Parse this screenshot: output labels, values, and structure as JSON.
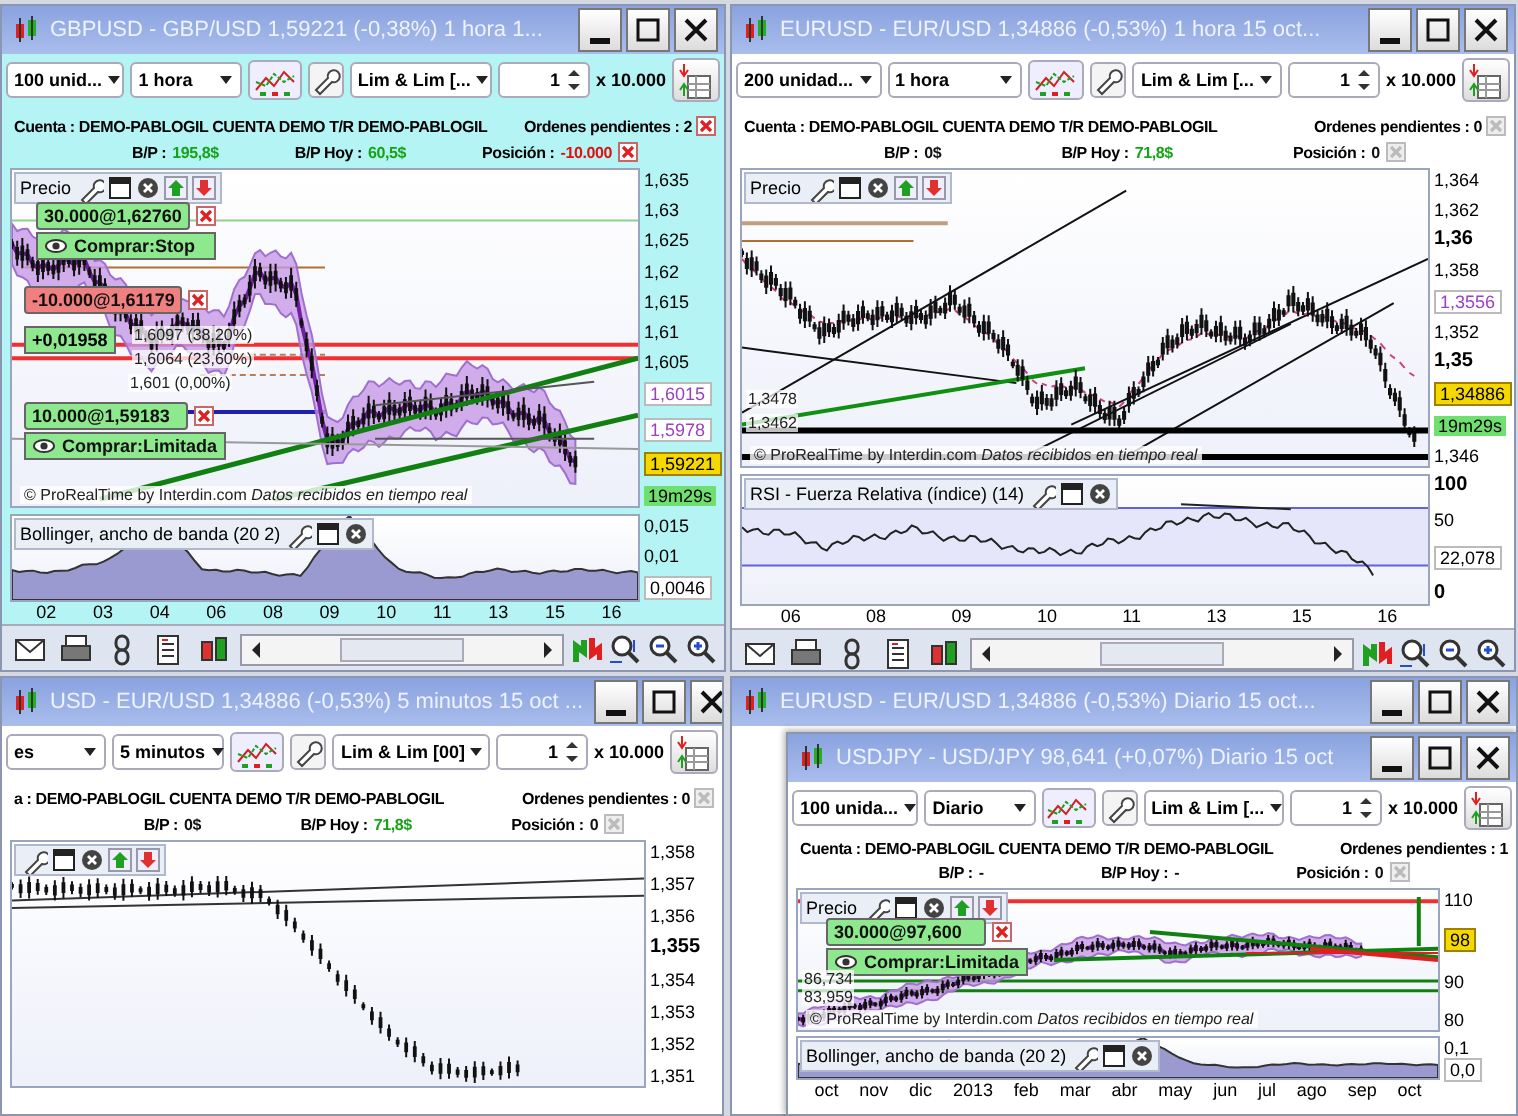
{
  "windows": [
    {
      "title": "GBPUSD - GBP/USD 1,59221 (-0,38%) 1 hora 1...",
      "focused": true,
      "toolbar": {
        "units": "100 unid...",
        "timeframe": "1 hora",
        "order_type": "Lim & Lim [...",
        "quantity": "1",
        "multiplier": "x 10.000"
      },
      "account": {
        "cuenta": "Cuenta : DEMO-PABLOGIL CUENTA DEMO T/R DEMO-PABLOGIL",
        "pending_label": "Ordenes pendientes :",
        "pending": "2",
        "pending_cancel_enabled": true,
        "stats": [
          {
            "label": "B/P :",
            "value": "195,8$",
            "color": "#17a317"
          },
          {
            "label": "B/P Hoy :",
            "value": "60,5$",
            "color": "#17a317"
          },
          {
            "label": "Posición :",
            "value": "-10.000",
            "color": "#e01010",
            "cancel_enabled": true
          }
        ]
      },
      "price_pane": {
        "label": "Precio",
        "overlays": [
          {
            "kind": "order",
            "text": "30.000@1,62760",
            "action": "Comprar:Stop",
            "color": "#8ee88e"
          },
          {
            "kind": "order",
            "text": "-10.000@1,61179",
            "color": "#f08080"
          },
          {
            "kind": "pnl",
            "text": "+0,01958"
          },
          {
            "kind": "level",
            "text": "1,6097 (38,20%)"
          },
          {
            "kind": "level",
            "text": "1,6064 (23,60%)"
          },
          {
            "kind": "level",
            "text": "1,601 (0,00%)"
          },
          {
            "kind": "order",
            "text": "10.000@1,59183",
            "action": "Comprar:Limitada",
            "color": "#8ee88e"
          },
          {
            "kind": "note",
            "text": "© ProRealTime by Interdin.com  *Datos recibidos en tiempo real*"
          }
        ],
        "axis": [
          {
            "kind": "tick",
            "text": "1,635"
          },
          {
            "kind": "tick",
            "text": "1,63"
          },
          {
            "kind": "tick",
            "text": "1,625"
          },
          {
            "kind": "tick",
            "text": "1,62"
          },
          {
            "kind": "tick",
            "text": "1,615"
          },
          {
            "kind": "tick",
            "text": "1,61"
          },
          {
            "kind": "tick",
            "text": "1,605"
          },
          {
            "kind": "level",
            "text": "1,6015"
          },
          {
            "kind": "level",
            "text": "1,5978"
          },
          {
            "kind": "price",
            "text": "1,59221"
          },
          {
            "kind": "timer",
            "text": "19m29s"
          }
        ]
      },
      "indicator": {
        "label": "Bollinger, ancho de banda (20 2)",
        "axis": [
          {
            "kind": "tick",
            "text": "0,015"
          },
          {
            "kind": "tick",
            "text": "0,01"
          },
          {
            "kind": "value",
            "text": "0,0046"
          }
        ]
      },
      "x_labels": [
        "02",
        "03",
        "04",
        "06",
        "08",
        "09",
        "10",
        "11",
        "13",
        "15",
        "16"
      ],
      "navigation_bar": true
    },
    {
      "title": "EURUSD - EUR/USD 1,34886 (-0,53%) 1 hora 15 oct...",
      "focused": false,
      "toolbar": {
        "units": "200 unidad...",
        "timeframe": "1 hora",
        "order_type": "Lim & Lim [...",
        "quantity": "1",
        "multiplier": "x 10.000"
      },
      "account": {
        "cuenta": "Cuenta : DEMO-PABLOGIL CUENTA DEMO T/R DEMO-PABLOGIL",
        "pending_label": "Ordenes pendientes :",
        "pending": "0",
        "pending_cancel_enabled": false,
        "stats": [
          {
            "label": "B/P :",
            "value": "0$",
            "color": "#111111"
          },
          {
            "label": "B/P Hoy :",
            "value": "71,8$",
            "color": "#17a317"
          },
          {
            "label": "Posición :",
            "value": "0",
            "color": "#111111",
            "cancel_enabled": false
          }
        ]
      },
      "price_pane": {
        "label": "Precio",
        "overlays": [
          {
            "kind": "level",
            "text": "1,3478"
          },
          {
            "kind": "level",
            "text": "1,3462"
          },
          {
            "kind": "note",
            "text": "© ProRealTime by Interdin.com  *Datos recibidos en tiempo real*"
          }
        ],
        "axis": [
          {
            "kind": "tick",
            "text": "1,364"
          },
          {
            "kind": "tick",
            "text": "1,362"
          },
          {
            "kind": "major",
            "text": "1,36"
          },
          {
            "kind": "tick",
            "text": "1,358"
          },
          {
            "kind": "level",
            "text": "1,3556"
          },
          {
            "kind": "tick",
            "text": "1,352"
          },
          {
            "kind": "major",
            "text": "1,35"
          },
          {
            "kind": "price",
            "text": "1,34886"
          },
          {
            "kind": "timer",
            "text": "19m29s"
          },
          {
            "kind": "tick",
            "text": "1,346"
          }
        ]
      },
      "indicator": {
        "label": "RSI - Fuerza Relativa (índice) (14)",
        "axis": [
          {
            "kind": "major",
            "text": "100"
          },
          {
            "kind": "tick",
            "text": "50"
          },
          {
            "kind": "value",
            "text": "22,078"
          },
          {
            "kind": "major",
            "text": "0"
          }
        ]
      },
      "x_labels": [
        "06",
        "08",
        "09",
        "10",
        "11",
        "13",
        "15",
        "16"
      ],
      "navigation_bar": true
    },
    {
      "title": "USD - EUR/USD 1,34886 (-0,53%) 5 minutos 15 oct ...",
      "focused": false,
      "toolbar": {
        "units": "es",
        "timeframe": "5 minutos",
        "order_type": "Lim & Lim [00]",
        "quantity": "1",
        "multiplier": "x 10.000"
      },
      "account": {
        "cuenta": "a : DEMO-PABLOGIL CUENTA DEMO T/R DEMO-PABLOGIL",
        "pending_label": "Ordenes pendientes :",
        "pending": "0",
        "pending_cancel_enabled": false,
        "stats": [
          {
            "label": "B/P :",
            "value": "0$",
            "color": "#111111"
          },
          {
            "label": "B/P Hoy :",
            "value": "71,8$",
            "color": "#17a317"
          },
          {
            "label": "Posición :",
            "value": "0",
            "color": "#111111",
            "cancel_enabled": false
          }
        ]
      },
      "price_pane": {
        "axis": [
          {
            "kind": "tick",
            "text": "1,358"
          },
          {
            "kind": "tick",
            "text": "1,357"
          },
          {
            "kind": "tick",
            "text": "1,356"
          },
          {
            "kind": "major",
            "text": "1,355"
          },
          {
            "kind": "tick",
            "text": "1,354"
          },
          {
            "kind": "tick",
            "text": "1,353"
          },
          {
            "kind": "tick",
            "text": "1,352"
          },
          {
            "kind": "tick",
            "text": "1,351"
          }
        ]
      }
    },
    {
      "title": "EURUSD - EUR/USD 1,34886 (-0,53%) Diario 15 oct...",
      "focused": false
    },
    {
      "title": "USDJPY - USD/JPY 98,641 (+0,07%) Diario 15 oct",
      "focused": false,
      "toolbar": {
        "units": "100 unida...",
        "timeframe": "Diario",
        "order_type": "Lim & Lim [...",
        "quantity": "1",
        "multiplier": "x 10.000"
      },
      "account": {
        "cuenta": "Cuenta : DEMO-PABLOGIL CUENTA DEMO T/R DEMO-PABLOGIL",
        "pending_label": "Ordenes pendientes :",
        "pending": "1",
        "stats": [
          {
            "label": "B/P :",
            "value": "-",
            "color": "#111111"
          },
          {
            "label": "B/P Hoy :",
            "value": "-",
            "color": "#111111"
          },
          {
            "label": "Posición :",
            "value": "0",
            "color": "#111111",
            "cancel_enabled": false
          }
        ]
      },
      "price_pane": {
        "label": "Precio",
        "overlays": [
          {
            "kind": "order",
            "text": "30.000@97,600",
            "action": "Comprar:Limitada",
            "color": "#8ee88e"
          },
          {
            "kind": "level",
            "text": "86,734"
          },
          {
            "kind": "level",
            "text": "83,959"
          },
          {
            "kind": "note",
            "text": "© ProRealTime by Interdin.com  *Datos recibidos en tiempo real*"
          }
        ],
        "axis": [
          {
            "kind": "tick",
            "text": "110"
          },
          {
            "kind": "price",
            "text": "98"
          },
          {
            "kind": "tick",
            "text": "90"
          },
          {
            "kind": "tick",
            "text": "80"
          }
        ]
      },
      "indicator": {
        "label": "Bollinger, ancho de banda (20 2)",
        "axis": [
          {
            "kind": "tick",
            "text": "0,1"
          },
          {
            "kind": "value",
            "text": "0,0"
          }
        ]
      },
      "x_labels": [
        "oct",
        "nov",
        "dic",
        "2013",
        "feb",
        "mar",
        "abr",
        "may",
        "jun",
        "jul",
        "ago",
        "sep",
        "oct"
      ]
    }
  ]
}
